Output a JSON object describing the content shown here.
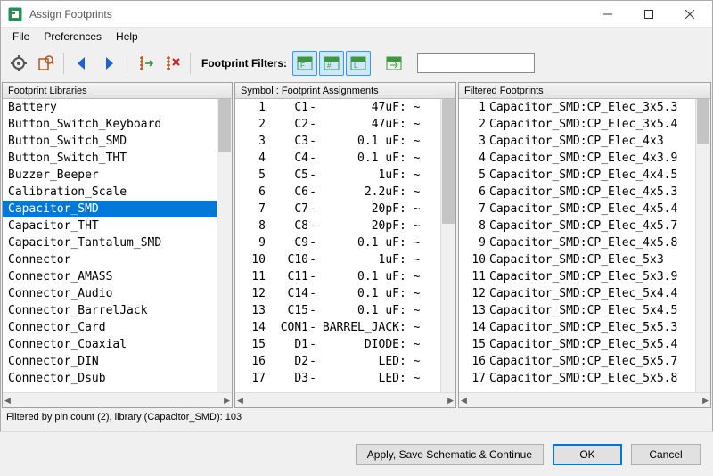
{
  "window": {
    "title": "Assign Footprints"
  },
  "menu": {
    "file": "File",
    "preferences": "Preferences",
    "help": "Help"
  },
  "toolbar": {
    "filters_label": "Footprint Filters:",
    "search_value": ""
  },
  "pane_headers": {
    "libs": "Footprint Libraries",
    "assign": "Symbol : Footprint Assignments",
    "filtered": "Filtered Footprints"
  },
  "libraries": [
    "Battery",
    "Button_Switch_Keyboard",
    "Button_Switch_SMD",
    "Button_Switch_THT",
    "Buzzer_Beeper",
    "Calibration_Scale",
    "Capacitor_SMD",
    "Capacitor_THT",
    "Capacitor_Tantalum_SMD",
    "Connector",
    "Connector_AMASS",
    "Connector_Audio",
    "Connector_BarrelJack",
    "Connector_Card",
    "Connector_Coaxial",
    "Connector_DIN",
    "Connector_Dsub"
  ],
  "libraries_selected_index": 6,
  "assignments": [
    {
      "n": 1,
      "ref": "C1",
      "val": "47uF",
      "fp": "~"
    },
    {
      "n": 2,
      "ref": "C2",
      "val": "47uF",
      "fp": "~"
    },
    {
      "n": 3,
      "ref": "C3",
      "val": "0.1 uF",
      "fp": "~"
    },
    {
      "n": 4,
      "ref": "C4",
      "val": "0.1 uF",
      "fp": "~"
    },
    {
      "n": 5,
      "ref": "C5",
      "val": "1uF",
      "fp": "~"
    },
    {
      "n": 6,
      "ref": "C6",
      "val": "2.2uF",
      "fp": "~"
    },
    {
      "n": 7,
      "ref": "C7",
      "val": "20pF",
      "fp": "~"
    },
    {
      "n": 8,
      "ref": "C8",
      "val": "20pF",
      "fp": "~"
    },
    {
      "n": 9,
      "ref": "C9",
      "val": "0.1 uF",
      "fp": "~"
    },
    {
      "n": 10,
      "ref": "C10",
      "val": "1uF",
      "fp": "~"
    },
    {
      "n": 11,
      "ref": "C11",
      "val": "0.1 uF",
      "fp": "~"
    },
    {
      "n": 12,
      "ref": "C14",
      "val": "0.1 uF",
      "fp": "~"
    },
    {
      "n": 13,
      "ref": "C15",
      "val": "0.1 uF",
      "fp": "~"
    },
    {
      "n": 14,
      "ref": "CON1",
      "val": "BARREL_JACK",
      "fp": "~"
    },
    {
      "n": 15,
      "ref": "D1",
      "val": "DIODE",
      "fp": "~"
    },
    {
      "n": 16,
      "ref": "D2",
      "val": "LED",
      "fp": "~"
    },
    {
      "n": 17,
      "ref": "D3",
      "val": "LED",
      "fp": "~"
    }
  ],
  "assignments_hilite_index": 7,
  "filtered": [
    {
      "n": 1,
      "name": "Capacitor_SMD:CP_Elec_3x5.3"
    },
    {
      "n": 2,
      "name": "Capacitor_SMD:CP_Elec_3x5.4"
    },
    {
      "n": 3,
      "name": "Capacitor_SMD:CP_Elec_4x3"
    },
    {
      "n": 4,
      "name": "Capacitor_SMD:CP_Elec_4x3.9"
    },
    {
      "n": 5,
      "name": "Capacitor_SMD:CP_Elec_4x4.5"
    },
    {
      "n": 6,
      "name": "Capacitor_SMD:CP_Elec_4x5.3"
    },
    {
      "n": 7,
      "name": "Capacitor_SMD:CP_Elec_4x5.4"
    },
    {
      "n": 8,
      "name": "Capacitor_SMD:CP_Elec_4x5.7"
    },
    {
      "n": 9,
      "name": "Capacitor_SMD:CP_Elec_4x5.8"
    },
    {
      "n": 10,
      "name": "Capacitor_SMD:CP_Elec_5x3"
    },
    {
      "n": 11,
      "name": "Capacitor_SMD:CP_Elec_5x3.9"
    },
    {
      "n": 12,
      "name": "Capacitor_SMD:CP_Elec_5x4.4"
    },
    {
      "n": 13,
      "name": "Capacitor_SMD:CP_Elec_5x4.5"
    },
    {
      "n": 14,
      "name": "Capacitor_SMD:CP_Elec_5x5.3"
    },
    {
      "n": 15,
      "name": "Capacitor_SMD:CP_Elec_5x5.4"
    },
    {
      "n": 16,
      "name": "Capacitor_SMD:CP_Elec_5x5.7"
    },
    {
      "n": 17,
      "name": "Capacitor_SMD:CP_Elec_5x5.8"
    }
  ],
  "status": "Filtered by pin count (2), library (Capacitor_SMD): 103",
  "buttons": {
    "apply": "Apply, Save Schematic & Continue",
    "ok": "OK",
    "cancel": "Cancel"
  }
}
